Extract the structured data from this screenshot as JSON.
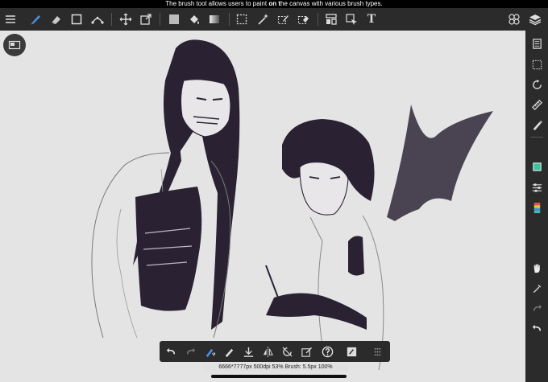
{
  "tooltip": {
    "text_before": "The brush tool allows users to paint ",
    "text_bold": "on t",
    "text_after": "he canvas with various brush types."
  },
  "top_toolbar": {
    "text_tool_glyph": "T"
  },
  "status": {
    "text": "6666*7777px 500dpi 53% Brush: 5.5px 100%"
  },
  "colors": {
    "toolbar_bg": "#2b2b2b",
    "accent": "#4a8fe0",
    "primary_color": "#3fc0a0",
    "canvas_bg": "#e4e4e4",
    "ink": "#2a2233"
  }
}
